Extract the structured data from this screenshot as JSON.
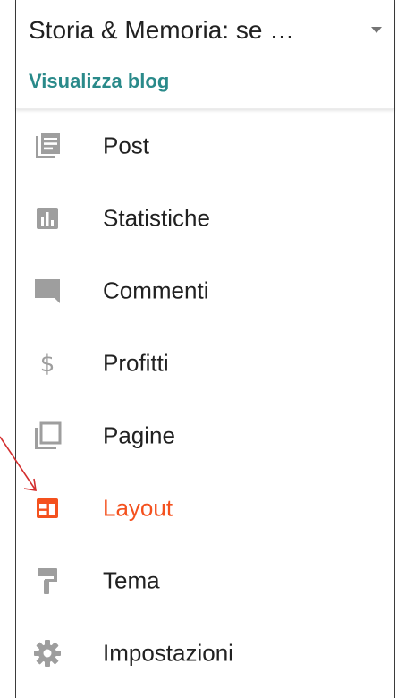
{
  "header": {
    "blog_title": "Storia & Memoria: se …",
    "view_blog_link": "Visualizza blog"
  },
  "sidebar": {
    "items": [
      {
        "label": "Post",
        "icon": "posts-icon"
      },
      {
        "label": "Statistiche",
        "icon": "stats-icon"
      },
      {
        "label": "Commenti",
        "icon": "comments-icon"
      },
      {
        "label": "Profitti",
        "icon": "dollar-icon"
      },
      {
        "label": "Pagine",
        "icon": "pages-icon"
      },
      {
        "label": "Layout",
        "icon": "layout-icon",
        "active": true
      },
      {
        "label": "Tema",
        "icon": "paint-roller-icon"
      },
      {
        "label": "Impostazioni",
        "icon": "gear-icon"
      }
    ]
  },
  "colors": {
    "accent": "#f4511e",
    "link": "#2a8a8a",
    "icon_gray": "#9e9e9e",
    "annotation_arrow": "#d32f2f"
  }
}
